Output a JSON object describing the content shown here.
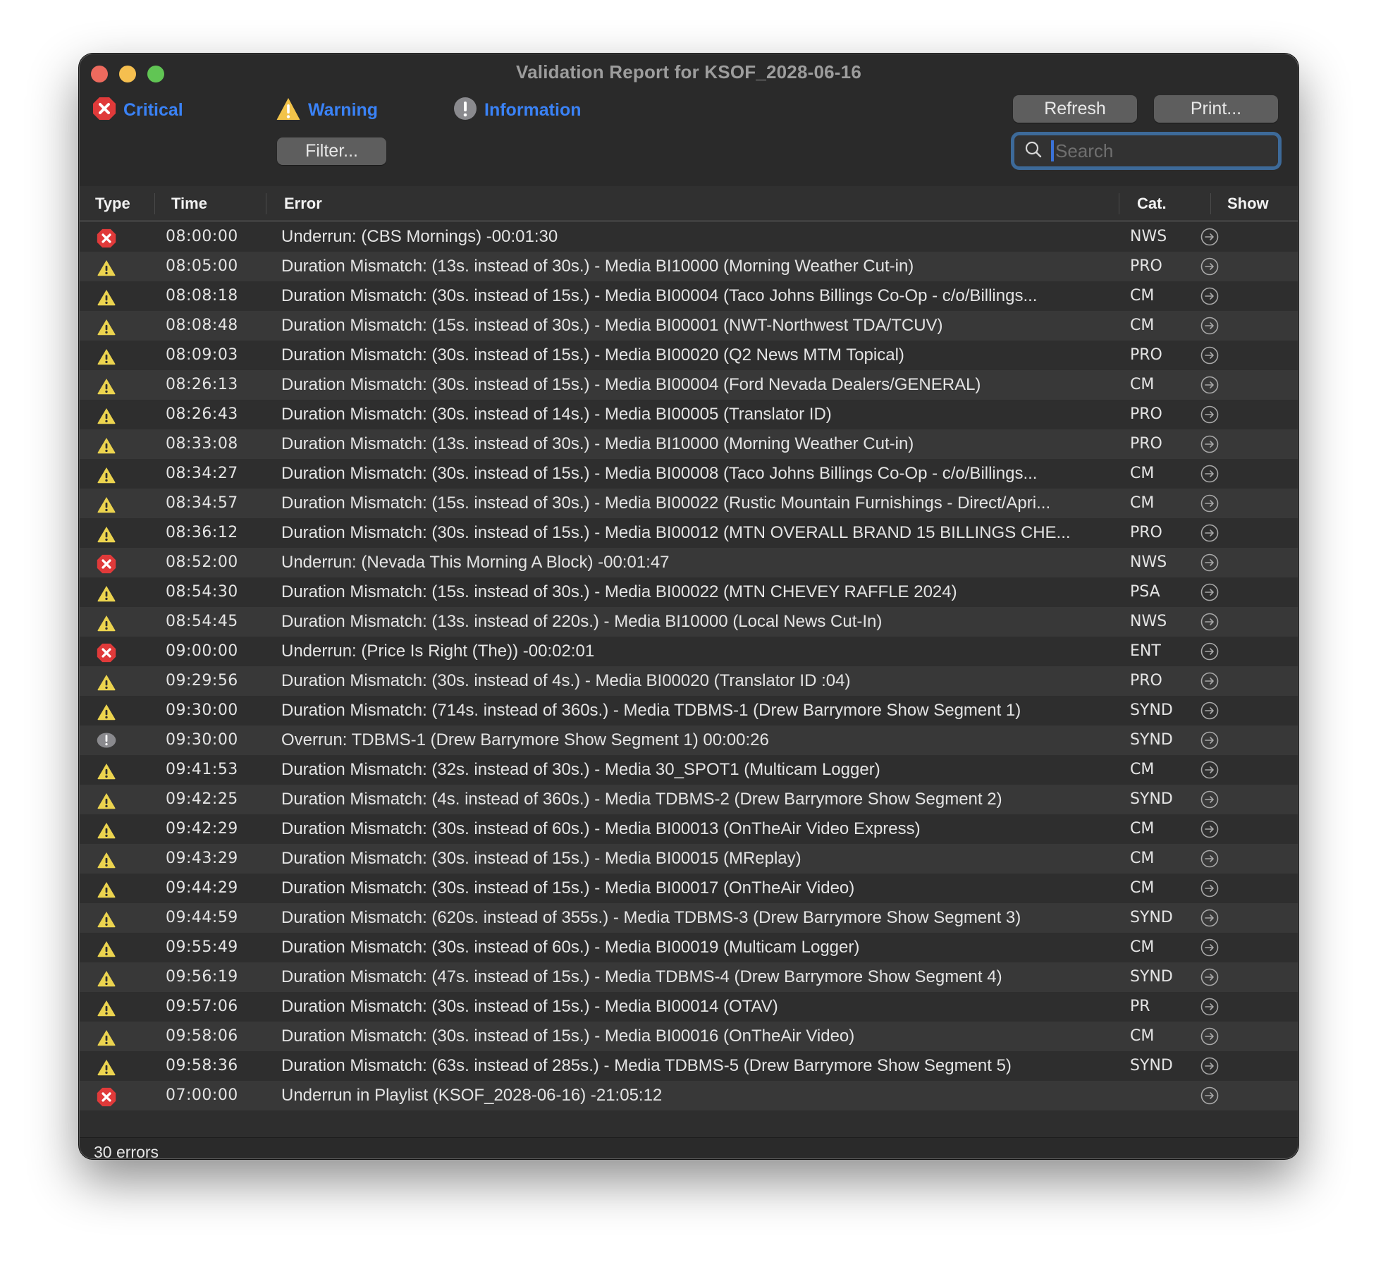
{
  "window": {
    "title": "Validation Report for KSOF_2028-06-16"
  },
  "legend": {
    "critical": {
      "label": "Critical",
      "icon": "critical-x-icon"
    },
    "warning": {
      "label": "Warning",
      "icon": "warning-triangle-icon"
    },
    "information": {
      "label": "Information",
      "icon": "info-exclamation-icon"
    }
  },
  "toolbar": {
    "filter_label": "Filter...",
    "refresh_label": "Refresh",
    "print_label": "Print...",
    "search_placeholder": "Search",
    "search_value": ""
  },
  "colors": {
    "accent": "#3a82f6",
    "critical": "#e03a3a",
    "warning": "#ecd44f",
    "information": "#8a8a8e",
    "search_focus": "#3d6a99"
  },
  "table": {
    "columns": [
      "Type",
      "Time",
      "Error",
      "Cat.",
      "Show"
    ],
    "rows": [
      {
        "type": "critical",
        "time": "08:00:00",
        "error": "Underrun:  (CBS Mornings) -00:01:30",
        "cat": "NWS"
      },
      {
        "type": "warning",
        "time": "08:05:00",
        "error": "Duration Mismatch: (13s. instead of 30s.) - Media BI10000 (Morning Weather Cut-in)",
        "cat": "PRO"
      },
      {
        "type": "warning",
        "time": "08:08:18",
        "error": "Duration Mismatch: (30s. instead of 15s.) - Media BI00004 (Taco Johns Billings Co-Op - c/o/Billings...",
        "cat": "CM"
      },
      {
        "type": "warning",
        "time": "08:08:48",
        "error": "Duration Mismatch: (15s. instead of 30s.) - Media BI00001 (NWT-Northwest TDA/TCUV)",
        "cat": "CM"
      },
      {
        "type": "warning",
        "time": "08:09:03",
        "error": "Duration Mismatch: (30s. instead of 15s.) - Media BI00020 (Q2 News MTM Topical)",
        "cat": "PRO"
      },
      {
        "type": "warning",
        "time": "08:26:13",
        "error": "Duration Mismatch: (30s. instead of 15s.) - Media BI00004 (Ford Nevada  Dealers/GENERAL)",
        "cat": "CM"
      },
      {
        "type": "warning",
        "time": "08:26:43",
        "error": "Duration Mismatch: (30s. instead of 14s.) - Media BI00005 (Translator ID)",
        "cat": "PRO"
      },
      {
        "type": "warning",
        "time": "08:33:08",
        "error": "Duration Mismatch: (13s. instead of 30s.) - Media BI10000 (Morning Weather Cut-in)",
        "cat": "PRO"
      },
      {
        "type": "warning",
        "time": "08:34:27",
        "error": "Duration Mismatch: (30s. instead of 15s.) - Media BI00008 (Taco Johns Billings Co-Op - c/o/Billings...",
        "cat": "CM"
      },
      {
        "type": "warning",
        "time": "08:34:57",
        "error": "Duration Mismatch: (15s. instead of 30s.) - Media BI00022 (Rustic Mountain Furnishings - Direct/Apri...",
        "cat": "CM"
      },
      {
        "type": "warning",
        "time": "08:36:12",
        "error": "Duration Mismatch: (30s. instead of 15s.) - Media BI00012 (MTN OVERALL BRAND 15 BILLINGS CHE...",
        "cat": "PRO"
      },
      {
        "type": "critical",
        "time": "08:52:00",
        "error": "Underrun:  (Nevada  This Morning A Block) -00:01:47",
        "cat": "NWS"
      },
      {
        "type": "warning",
        "time": "08:54:30",
        "error": "Duration Mismatch: (15s. instead of 30s.) - Media BI00022 (MTN CHEVEY RAFFLE 2024)",
        "cat": "PSA"
      },
      {
        "type": "warning",
        "time": "08:54:45",
        "error": "Duration Mismatch: (13s. instead of 220s.) - Media BI10000 (Local News Cut-In)",
        "cat": "NWS"
      },
      {
        "type": "critical",
        "time": "09:00:00",
        "error": "Underrun:  (Price Is Right (The)) -00:02:01",
        "cat": "ENT"
      },
      {
        "type": "warning",
        "time": "09:29:56",
        "error": "Duration Mismatch: (30s. instead of 4s.) - Media BI00020 (Translator ID :04)",
        "cat": "PRO"
      },
      {
        "type": "warning",
        "time": "09:30:00",
        "error": "Duration Mismatch: (714s. instead of 360s.) - Media TDBMS-1 (Drew Barrymore Show Segment 1)",
        "cat": "SYND"
      },
      {
        "type": "information",
        "time": "09:30:00",
        "error": "Overrun: TDBMS-1 (Drew Barrymore Show Segment 1) 00:00:26",
        "cat": "SYND"
      },
      {
        "type": "warning",
        "time": "09:41:53",
        "error": "Duration Mismatch: (32s. instead of 30s.) - Media 30_SPOT1 (Multicam Logger)",
        "cat": "CM"
      },
      {
        "type": "warning",
        "time": "09:42:25",
        "error": "Duration Mismatch: (4s. instead of 360s.) - Media TDBMS-2 (Drew Barrymore Show Segment 2)",
        "cat": "SYND"
      },
      {
        "type": "warning",
        "time": "09:42:29",
        "error": "Duration Mismatch: (30s. instead of 60s.) - Media BI00013 (OnTheAir Video Express)",
        "cat": "CM"
      },
      {
        "type": "warning",
        "time": "09:43:29",
        "error": "Duration Mismatch: (30s. instead of 15s.) - Media BI00015 (MReplay)",
        "cat": "CM"
      },
      {
        "type": "warning",
        "time": "09:44:29",
        "error": "Duration Mismatch: (30s. instead of 15s.) - Media BI00017 (OnTheAir Video)",
        "cat": "CM"
      },
      {
        "type": "warning",
        "time": "09:44:59",
        "error": "Duration Mismatch: (620s. instead of 355s.) - Media TDBMS-3 (Drew Barrymore Show Segment 3)",
        "cat": "SYND"
      },
      {
        "type": "warning",
        "time": "09:55:49",
        "error": "Duration Mismatch: (30s. instead of 60s.) - Media BI00019 (Multicam Logger)",
        "cat": "CM"
      },
      {
        "type": "warning",
        "time": "09:56:19",
        "error": "Duration Mismatch: (47s. instead of 15s.) - Media TDBMS-4 (Drew Barrymore Show Segment 4)",
        "cat": "SYND"
      },
      {
        "type": "warning",
        "time": "09:57:06",
        "error": "Duration Mismatch: (30s. instead of 15s.) - Media BI00014 (OTAV)",
        "cat": "PR"
      },
      {
        "type": "warning",
        "time": "09:58:06",
        "error": "Duration Mismatch: (30s. instead of 15s.) - Media BI00016 (OnTheAir Video)",
        "cat": "CM"
      },
      {
        "type": "warning",
        "time": "09:58:36",
        "error": "Duration Mismatch: (63s. instead of 285s.) - Media TDBMS-5 (Drew Barrymore Show Segment 5)",
        "cat": "SYND"
      },
      {
        "type": "critical",
        "time": "07:00:00",
        "error": "Underrun in Playlist (KSOF_2028-06-16) -21:05:12",
        "cat": ""
      }
    ]
  },
  "footer": {
    "status": "30 errors"
  }
}
